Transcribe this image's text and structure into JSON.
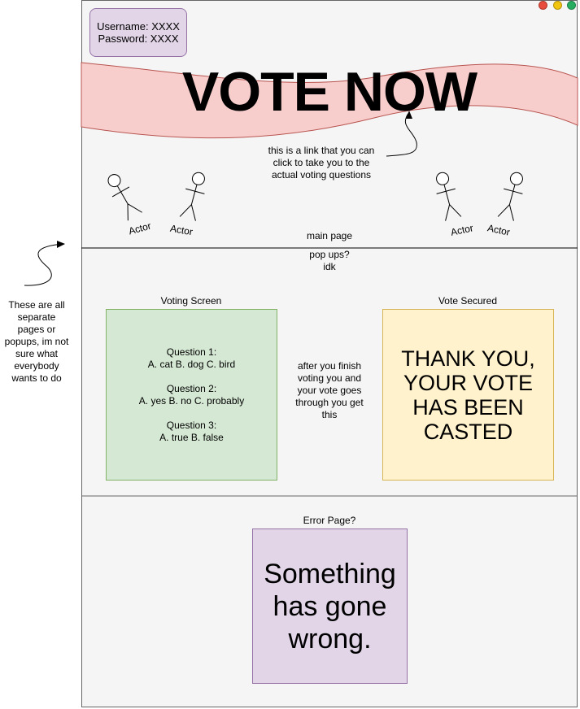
{
  "window_controls": {
    "close_color": "#e74c3c",
    "minimize_color": "#f1c40f",
    "maximize_color": "#27ae60"
  },
  "login": {
    "username": "Username: XXXX",
    "password": "Password: XXXX"
  },
  "banner": {
    "title": "VOTE NOW",
    "fill_color": "#f8cecc",
    "stroke_color": "#b85450"
  },
  "annotations": {
    "link_note": [
      "this is a link that you can",
      "click to take you to the",
      "actual voting questions"
    ],
    "main_page": "main page",
    "popups": [
      "pop ups?",
      "idk"
    ],
    "after_voting": [
      "after you finish",
      "voting you and",
      "your vote goes",
      "through you get",
      "this"
    ],
    "side_note": [
      "These are all",
      "separate",
      "pages or",
      "popups, im not",
      "sure what",
      "everybody",
      "wants to do"
    ]
  },
  "actors": [
    "Actor",
    "Actor",
    "Actor",
    "Actor"
  ],
  "voting_screen": {
    "label": "Voting Screen",
    "questions": [
      {
        "title": "Question 1:",
        "options": "A. cat B. dog C. bird"
      },
      {
        "title": "Question 2:",
        "options": "A. yes B. no C. probably"
      },
      {
        "title": "Question 3:",
        "options": "A. true B. false"
      }
    ]
  },
  "vote_secured": {
    "label": "Vote Secured",
    "lines": [
      "THANK YOU,",
      "YOUR VOTE",
      "HAS BEEN",
      "CASTED"
    ]
  },
  "error_page": {
    "label": "Error Page?",
    "lines": [
      "Something",
      "has gone",
      "wrong."
    ]
  }
}
